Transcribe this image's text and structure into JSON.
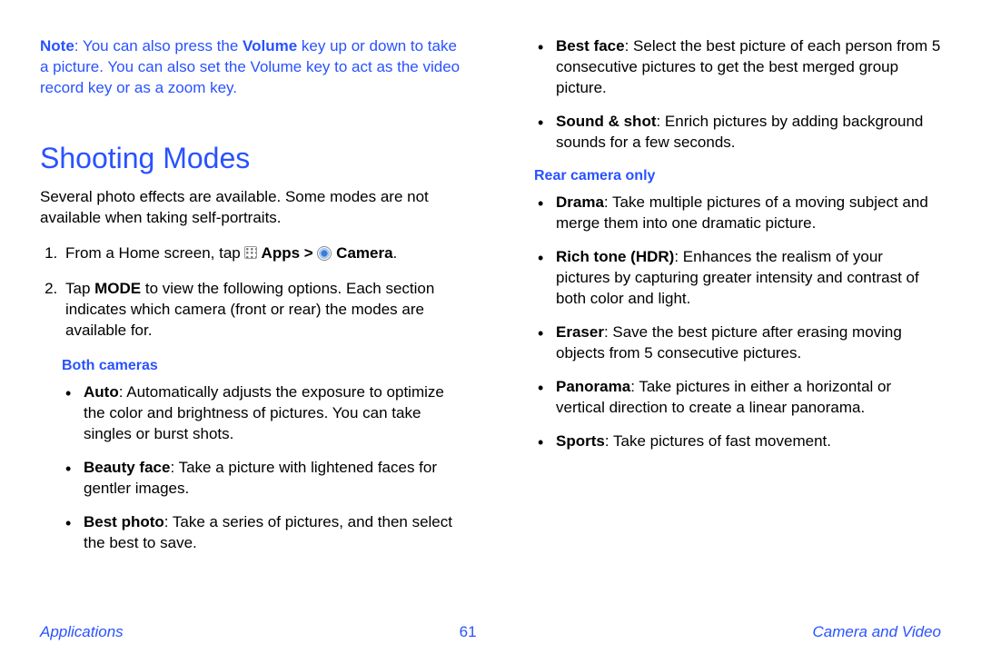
{
  "note_prefix": "Note",
  "note_body_1": ": You can also press the ",
  "note_bold_1": "Volume",
  "note_body_2": " key up or down to take a picture. You can also set the Volume key to act as the video record key or as a zoom key.",
  "heading": "Shooting Modes",
  "intro": "Several photo effects are available. Some modes are not available when taking self-portraits.",
  "step1_a": "From a Home screen, tap ",
  "step1_b": " Apps > ",
  "step1_c": " Camera",
  "step1_d": ".",
  "step2_a": "Tap ",
  "step2_b": "MODE",
  "step2_c": " to view the following options. Each section indicates which camera (front or rear) the modes are available for.",
  "subhead_both": "Both cameras",
  "both": [
    {
      "name": "Auto",
      "desc": ": Automatically adjusts the exposure to optimize the color and brightness of pictures. You can take singles or burst shots."
    },
    {
      "name": "Beauty face",
      "desc": ": Take a picture with lightened faces for gentler images."
    },
    {
      "name": "Best photo",
      "desc": ": Take a series of pictures, and then select the best to save."
    }
  ],
  "col2_top": [
    {
      "name": "Best face",
      "desc": ": Select the best picture of each person from 5 consecutive pictures to get the best merged group picture."
    },
    {
      "name": "Sound & shot",
      "desc": ": Enrich pictures by adding background sounds for a few seconds."
    }
  ],
  "subhead_rear": "Rear camera only",
  "rear": [
    {
      "name": "Drama",
      "desc": ": Take multiple pictures of a moving subject and merge them into one dramatic picture."
    },
    {
      "name": "Rich tone (HDR)",
      "desc": ": Enhances the realism of your pictures by capturing greater intensity and contrast of both color and light."
    },
    {
      "name": "Eraser",
      "desc": ": Save the best picture after erasing moving objects from 5 consecutive pictures."
    },
    {
      "name": "Panorama",
      "desc": ": Take pictures in either a horizontal or vertical direction to create a linear panorama."
    },
    {
      "name": "Sports",
      "desc": ": Take pictures of fast movement."
    }
  ],
  "footer_left": "Applications",
  "footer_center": "61",
  "footer_right": "Camera and Video"
}
